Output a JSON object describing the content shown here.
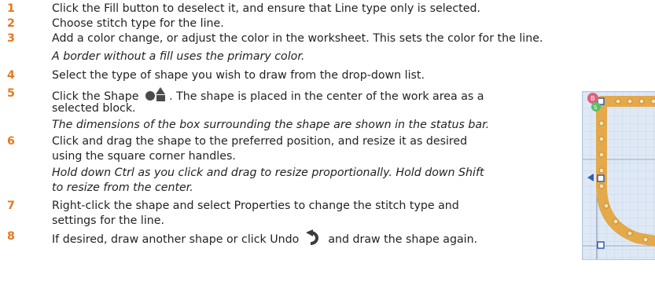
{
  "steps": [
    {
      "number": "1",
      "lines": [
        {
          "text": "Click the Fill button to deselect it, and ensure that Line type only is selected.",
          "italic": false
        }
      ]
    },
    {
      "number": "2",
      "lines": [
        {
          "text": "Choose stitch type for the line.",
          "italic": false
        }
      ]
    },
    {
      "number": "3",
      "lines": [
        {
          "text": "Add a color change, or adjust the color in the worksheet. This sets the color for the line.",
          "italic": false
        },
        {
          "text": "A border without a fill uses the primary color.",
          "italic": true
        }
      ]
    },
    {
      "number": "4",
      "lines": [
        {
          "text": "Select the type of shape you wish to draw from the drop-down list.",
          "italic": false
        }
      ]
    },
    {
      "number": "5",
      "lines": [
        {
          "text": "Click the Shape",
          "after": ". The shape is placed in the center of the work area as a",
          "italic": false,
          "icon": "shape-icon"
        },
        {
          "text": "selected block.",
          "italic": false
        },
        {
          "text": "The dimensions of the box surrounding the shape are shown in the status bar.",
          "italic": true
        }
      ]
    },
    {
      "number": "6",
      "lines": [
        {
          "text": "Click and drag the shape to the preferred position, and resize it as desired",
          "italic": false
        },
        {
          "text": "using the square corner handles.",
          "italic": false
        },
        {
          "text": "Hold down Ctrl as you click and drag to resize proportionally. Hold down Shift",
          "italic": true
        },
        {
          "text": "to resize from the center.",
          "italic": true
        }
      ]
    },
    {
      "number": "7",
      "lines": [
        {
          "text": "Right-click the shape and select Properties to change the stitch type and",
          "italic": false
        },
        {
          "text": "settings for the line.",
          "italic": false
        }
      ]
    },
    {
      "number": "8",
      "lines": [
        {
          "text": "If desired, draw another shape or click Undo",
          "after": " and draw the shape again.",
          "italic": false,
          "icon": "undo-icon"
        }
      ]
    }
  ],
  "colors": {
    "step_number": "#e8771f",
    "body_text": "#231f20",
    "undo_icon": "#3c3c3c",
    "shape_icon": "#4a4a4a"
  },
  "screenshot": {
    "labels": [
      "B",
      "S"
    ],
    "description_icon": "shape-on-canvas-icon"
  }
}
